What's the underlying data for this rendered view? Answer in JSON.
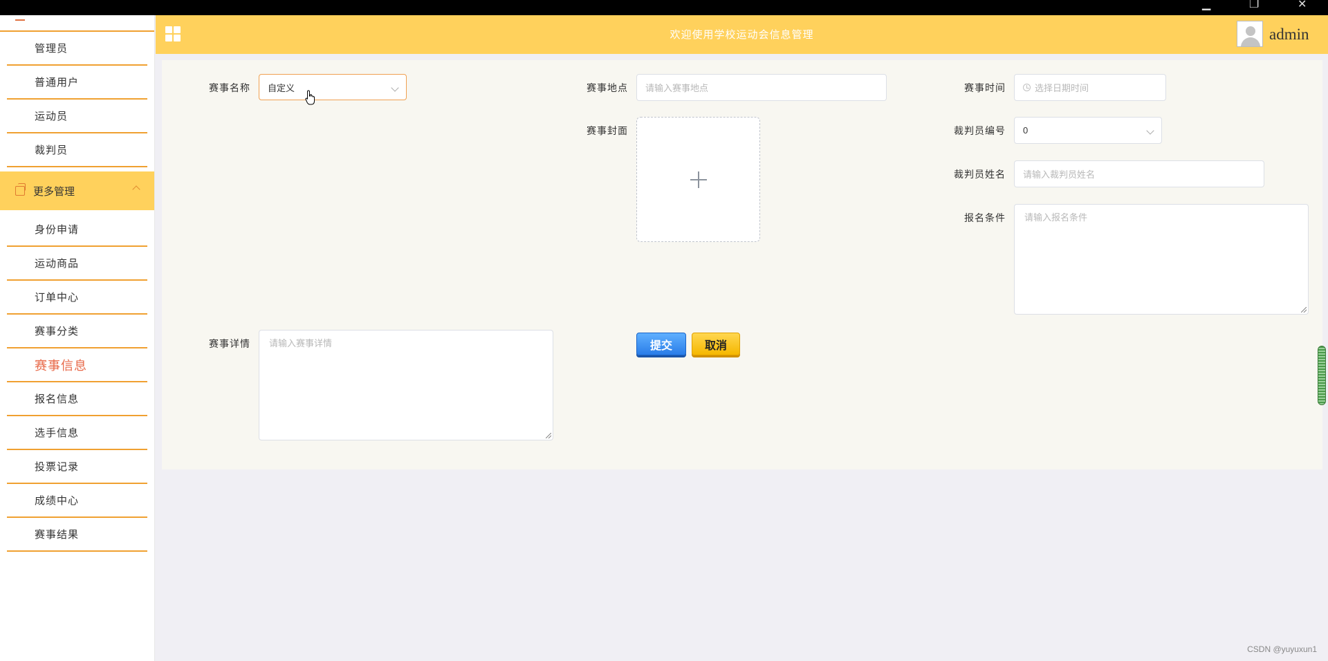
{
  "sidebar": {
    "items_top": [
      {
        "label": "管理员"
      },
      {
        "label": "普通用户"
      },
      {
        "label": "运动员"
      },
      {
        "label": "裁判员"
      }
    ],
    "group": {
      "label": "更多管理"
    },
    "items_group": [
      {
        "label": "身份申请"
      },
      {
        "label": "运动商品"
      },
      {
        "label": "订单中心"
      },
      {
        "label": "赛事分类"
      },
      {
        "label": "赛事信息",
        "active": true
      },
      {
        "label": "报名信息"
      },
      {
        "label": "选手信息"
      },
      {
        "label": "投票记录"
      },
      {
        "label": "成绩中心"
      },
      {
        "label": "赛事结果"
      }
    ]
  },
  "header": {
    "title": "欢迎使用学校运动会信息管理",
    "username": "admin"
  },
  "form": {
    "event_name": {
      "label": "赛事名称",
      "value": "自定义"
    },
    "event_location": {
      "label": "赛事地点",
      "placeholder": "请输入赛事地点"
    },
    "event_time": {
      "label": "赛事时间",
      "placeholder": "选择日期时间"
    },
    "event_cover": {
      "label": "赛事封面"
    },
    "referee_no": {
      "label": "裁判员编号",
      "value": "0"
    },
    "referee_name": {
      "label": "裁判员姓名",
      "placeholder": "请输入裁判员姓名"
    },
    "signup_condition": {
      "label": "报名条件",
      "placeholder": "请输入报名条件"
    },
    "event_detail": {
      "label": "赛事详情",
      "placeholder": "请输入赛事详情"
    },
    "submit_label": "提交",
    "cancel_label": "取消"
  },
  "watermark": "CSDN @yuyuxun1"
}
